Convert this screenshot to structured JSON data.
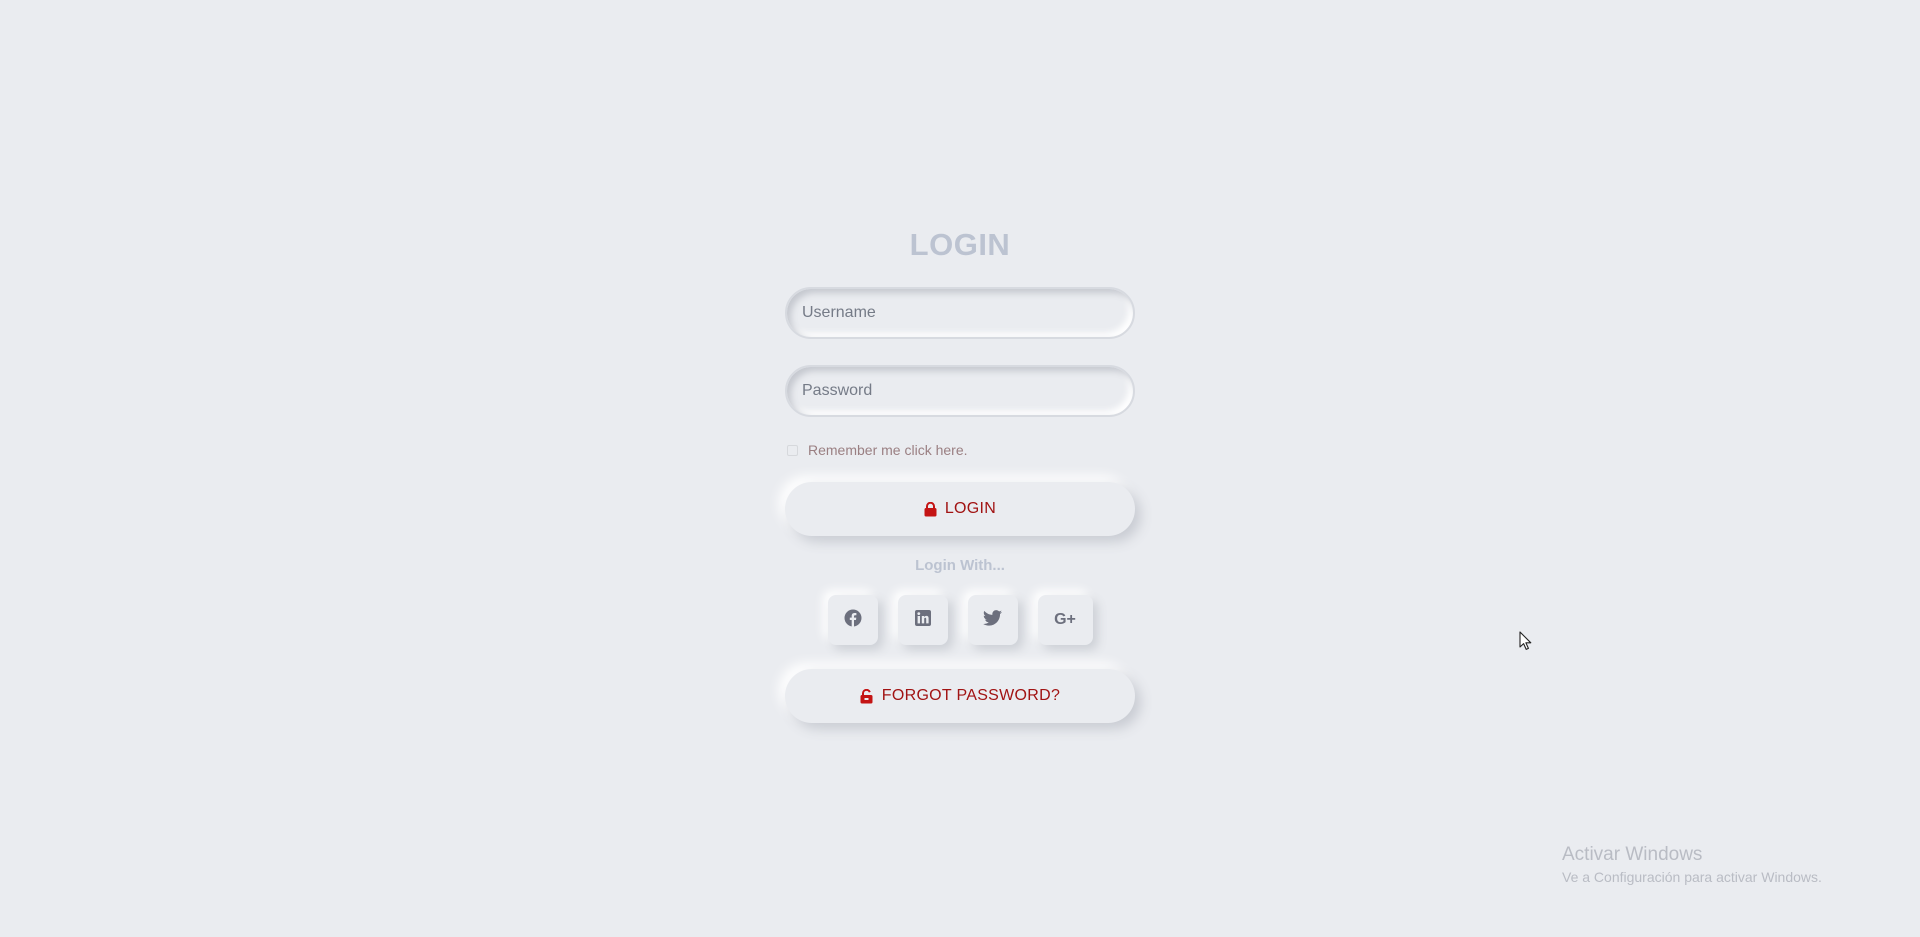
{
  "login_form": {
    "title": "LOGIN",
    "username_placeholder": "Username",
    "password_placeholder": "Password",
    "remember_label": "Remember me click here.",
    "login_button_label": "LOGIN",
    "login_with_label": "Login With...",
    "social_buttons": [
      {
        "name": "facebook",
        "icon": "facebook-icon"
      },
      {
        "name": "linkedin",
        "icon": "linkedin-icon"
      },
      {
        "name": "twitter",
        "icon": "twitter-icon"
      },
      {
        "name": "google-plus",
        "icon": "google-plus-icon",
        "glyph": "G+"
      }
    ],
    "forgot_password_label": "FORGOT PASSWORD?"
  },
  "watermark": {
    "title": "Activar Windows",
    "subtitle": "Ve a Configuración para activar Windows."
  },
  "colors": {
    "background": "#eaecf0",
    "accent": "#a11313",
    "title": "#bcc3d1",
    "icon": "#6c6f7d"
  }
}
